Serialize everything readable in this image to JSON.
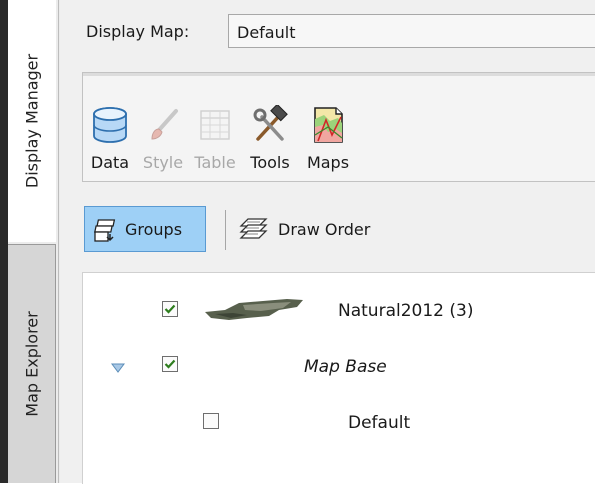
{
  "tabs": [
    {
      "label": "Display Manager",
      "active": true
    },
    {
      "label": "Map Explorer",
      "active": false
    }
  ],
  "display_map": {
    "label": "Display Map:",
    "value": "Default"
  },
  "toolbar": {
    "tools": [
      {
        "label": "Data",
        "icon": "database-icon",
        "enabled": true
      },
      {
        "label": "Style",
        "icon": "paintbrush-icon",
        "enabled": false
      },
      {
        "label": "Table",
        "icon": "table-grid-icon",
        "enabled": false
      },
      {
        "label": "Tools",
        "icon": "hammer-wrench-icon",
        "enabled": true
      },
      {
        "label": "Maps",
        "icon": "map-document-icon",
        "enabled": true
      }
    ]
  },
  "layer_view": {
    "groups_label": "Groups",
    "groups_selected": true,
    "draw_order_label": "Draw Order"
  },
  "tree": [
    {
      "label": "Natural2012 (3)",
      "checked": true,
      "italic": false,
      "has_thumbnail": true
    },
    {
      "label": "Map Base",
      "checked": true,
      "italic": true,
      "expanded": true
    },
    {
      "label": "Default",
      "checked": false,
      "italic": false
    }
  ],
  "colors": {
    "selected_button": "#9ed0f6",
    "checkmark": "#2e7d1e",
    "expander": "#5b8db8"
  }
}
